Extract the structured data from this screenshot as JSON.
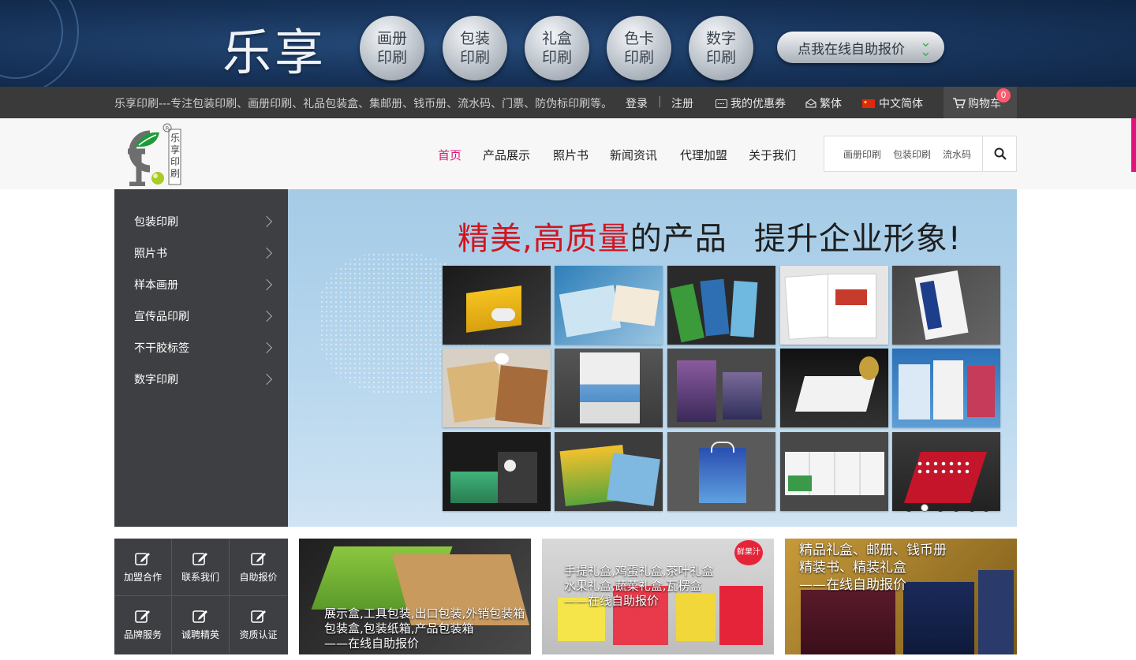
{
  "banner": {
    "brand": "乐享",
    "bubbles": [
      {
        "l1": "画册",
        "l2": "印刷"
      },
      {
        "l1": "包装",
        "l2": "印刷"
      },
      {
        "l1": "礼盒",
        "l2": "印刷"
      },
      {
        "l1": "色卡",
        "l2": "印刷"
      },
      {
        "l1": "数字",
        "l2": "印刷"
      }
    ],
    "quote_button": "点我在线自助报价"
  },
  "topbar": {
    "slogan": "乐享印刷---专注包装印刷、画册印刷、礼品包装盒、集邮册、钱币册、流水码、门票、防伪标印刷等。",
    "login": "登录",
    "divider": "|",
    "register": "注册",
    "coupons": "我的优惠券",
    "traditional": "繁体",
    "simplified": "中文简体",
    "cart": "购物车",
    "cart_count": "0"
  },
  "logo": {
    "text": "乐享印刷",
    "reg": "®"
  },
  "nav": {
    "items": [
      "首页",
      "产品展示",
      "照片书",
      "新闻资讯",
      "代理加盟",
      "关于我们"
    ]
  },
  "search": {
    "keywords": [
      "画册印刷",
      "包装印刷",
      "流水码"
    ]
  },
  "sidebar": {
    "items": [
      "包装印刷",
      "照片书",
      "样本画册",
      "宣传品印刷",
      "不干胶标签",
      "数字印刷"
    ]
  },
  "hero": {
    "title_red1": "精美",
    "title_sep": ",",
    "title_red2": "高质量",
    "title_dark1": "的产品",
    "title_dark2": "提升企业形象!",
    "slide_count": 6,
    "active_slide": 1
  },
  "quick_links": [
    "加盟合作",
    "联系我们",
    "自助报价",
    "品牌服务",
    "诚聘精英",
    "资质认证"
  ],
  "promos": [
    {
      "line1": "展示盒,工具包装,出口包装,外销包装箱",
      "line2": "包装盒,包装纸箱,产品包装箱",
      "line3": "——在线自助报价"
    },
    {
      "line1": "手提礼盒,鸡蛋礼盒,茶叶礼盒",
      "line2": "水果礼盒,蔬菜礼盒,瓦楞盒",
      "line3": "——在线自助报价",
      "badge": "鲜果汁"
    },
    {
      "line1": "精品礼盒、邮册、钱币册",
      "line2": "精装书、精装礼盒",
      "line3": "——在线自助报价"
    }
  ],
  "colors": {
    "accent": "#e0147a",
    "sidebar": "#3d3f42",
    "topbar": "#3a3a3a",
    "hero_red": "#d0151f"
  }
}
